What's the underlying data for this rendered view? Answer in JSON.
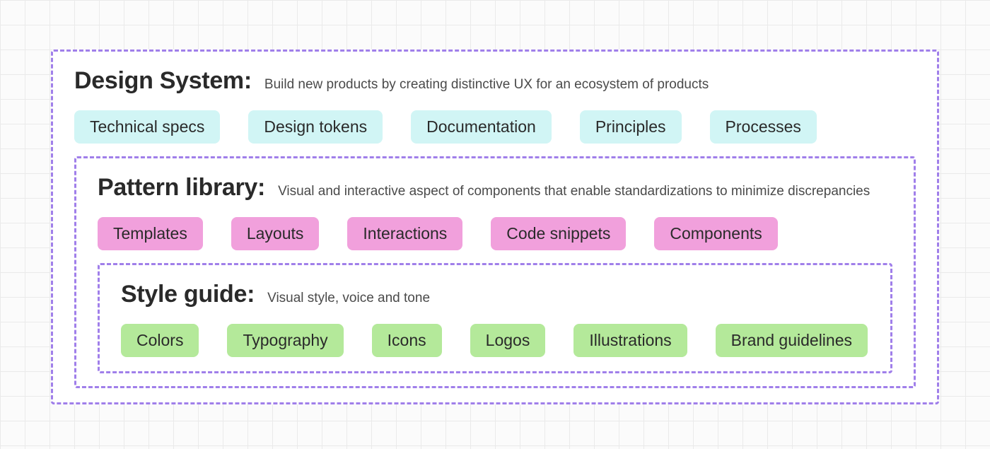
{
  "design_system": {
    "title": "Design System:",
    "desc": "Build new products by creating distinctive UX for an ecosystem of products",
    "items": [
      "Technical specs",
      "Design tokens",
      "Documentation",
      "Principles",
      "Processes"
    ]
  },
  "pattern_library": {
    "title": "Pattern library:",
    "desc": "Visual and interactive aspect of components that enable standardizations to minimize discrepancies",
    "items": [
      "Templates",
      "Layouts",
      "Interactions",
      "Code snippets",
      "Components"
    ]
  },
  "style_guide": {
    "title": "Style guide:",
    "desc": "Visual style, voice and tone",
    "items": [
      "Colors",
      "Typography",
      "Icons",
      "Logos",
      "Illustrations",
      "Brand guidelines"
    ]
  }
}
